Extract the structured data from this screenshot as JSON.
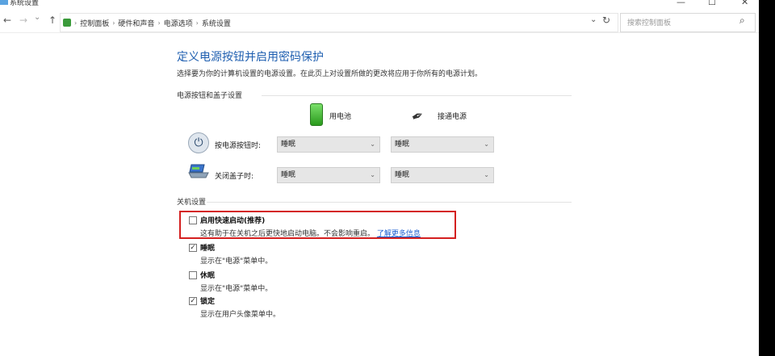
{
  "window": {
    "title": "系统设置",
    "minimize": "—",
    "maximize": "☐",
    "close": "✕"
  },
  "nav": {
    "back": "←",
    "forward": "→",
    "recent": "⌄",
    "up": "↑",
    "breadcrumb": [
      "控制面板",
      "硬件和声音",
      "电源选项",
      "系统设置"
    ],
    "separator": "›",
    "dropdown": "⌄",
    "refresh": "↻",
    "search_placeholder": "搜索控制面板",
    "search_icon": "⌕"
  },
  "content": {
    "title": "定义电源按钮并启用密码保护",
    "description": "选择要为你的计算机设置的电源设置。在此页上对设置所做的更改将应用于你所有的电源计划。",
    "section_power": "电源按钮和盖子设置",
    "columns": {
      "battery": "用电池",
      "plugged": "接通电源"
    },
    "rows": [
      {
        "label": "按电源按钮时:",
        "battery": "睡眠",
        "plugged": "睡眠"
      },
      {
        "label": "关闭盖子时:",
        "battery": "睡眠",
        "plugged": "睡眠"
      }
    ],
    "select_arrow": "⌄",
    "section_shutdown": "关机设置",
    "options": [
      {
        "title": "启用快速启动(推荐)",
        "desc": "这有助于在关机之后更快地启动电脑。不会影响重启。",
        "link": "了解更多信息",
        "checked": false,
        "mark": ""
      },
      {
        "title": "睡眠",
        "desc": "显示在\"电源\"菜单中。",
        "checked": true,
        "mark": "✓"
      },
      {
        "title": "休眠",
        "desc": "显示在\"电源\"菜单中。",
        "checked": false,
        "mark": ""
      },
      {
        "title": "锁定",
        "desc": "显示在用户头像菜单中。",
        "checked": true,
        "mark": "✓"
      }
    ]
  },
  "colors": {
    "title_blue": "#1f5fb0",
    "link_blue": "#1c5fd1",
    "highlight_red": "#d42020"
  },
  "icons": {
    "power": "power-icon",
    "lid": "laptop-lid-icon",
    "battery": "battery-icon",
    "plug": "plug-icon",
    "glyph_power": "⏻",
    "glyph_plug": "✒"
  }
}
